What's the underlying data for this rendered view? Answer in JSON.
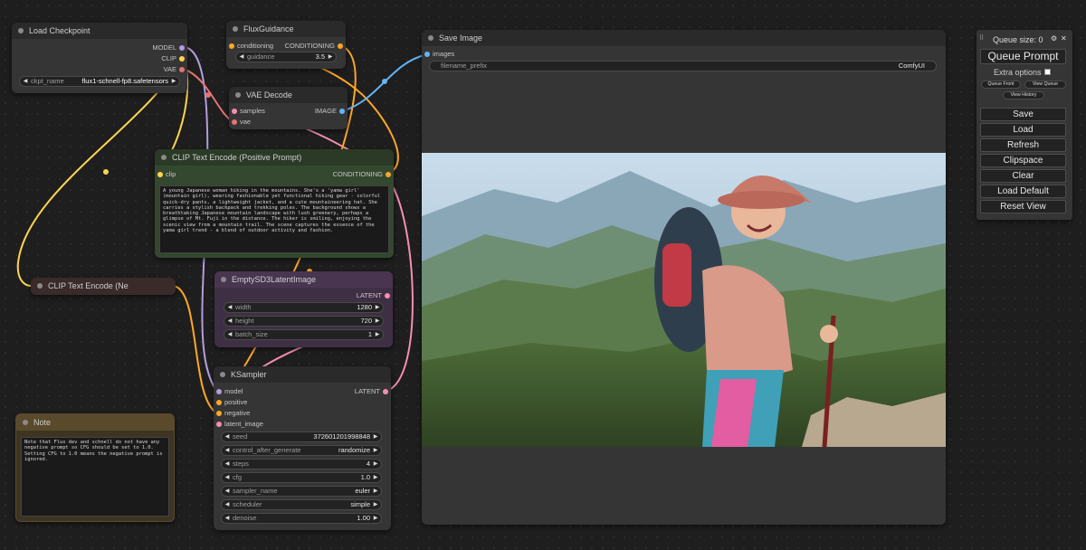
{
  "colors": {
    "canvas": "#1e1e1e",
    "node_body": "#353535",
    "node_title": "#2a2a2a",
    "clip_pos_body": "#34472f",
    "clip_pos_title": "#2a3a26",
    "latent_body": "#3f2f44",
    "latent_title": "#4a3550",
    "note_body": "#3d3522",
    "note_title": "#5a4a2c",
    "model_wire": "#b39ddb",
    "clip_wire": "#ffd54f",
    "vae_wire": "#e57373",
    "conditioning_wire": "#ffa726",
    "image_wire": "#64b5f6",
    "latent_wire": "#f48fb1"
  },
  "load_checkpoint": {
    "title": "Load Checkpoint",
    "outputs": [
      "MODEL",
      "CLIP",
      "VAE"
    ],
    "ckpt_label": "ckpt_name",
    "ckpt_value": "flux1-schnell-fp8.safetensors"
  },
  "flux_guidance": {
    "title": "FluxGuidance",
    "input": "conditioning",
    "output": "CONDITIONING",
    "guidance_label": "guidance",
    "guidance_value": "3.5"
  },
  "vae_decode": {
    "title": "VAE Decode",
    "inputs": [
      "samples",
      "vae"
    ],
    "output": "IMAGE"
  },
  "clip_positive": {
    "title": "CLIP Text Encode (Positive Prompt)",
    "input": "clip",
    "output": "CONDITIONING",
    "text": "A young Japanese woman hiking in the mountains. She's a 'yama girl' (mountain girl), wearing fashionable yet functional hiking gear - colorful quick-dry pants, a lightweight jacket, and a cute mountaineering hat. She carries a stylish backpack and trekking poles. The background shows a breathtaking Japanese mountain landscape with lush greenery, perhaps a glimpse of Mt. Fuji in the distance. The hiker is smiling, enjoying the scenic view from a mountain trail. The scene captures the essence of the yama girl trend - a blend of outdoor activity and fashion."
  },
  "clip_negative": {
    "title": "CLIP Text Encode (Ne"
  },
  "empty_latent": {
    "title": "EmptySD3LatentImage",
    "output": "LATENT",
    "widgets": [
      {
        "label": "width",
        "value": "1280"
      },
      {
        "label": "height",
        "value": "720"
      },
      {
        "label": "batch_size",
        "value": "1"
      }
    ]
  },
  "ksampler": {
    "title": "KSampler",
    "output": "LATENT",
    "inputs": [
      "model",
      "positive",
      "negative",
      "latent_image"
    ],
    "widgets": [
      {
        "label": "seed",
        "value": "372601201998848"
      },
      {
        "label": "control_after_generate",
        "value": "randomize"
      },
      {
        "label": "steps",
        "value": "4"
      },
      {
        "label": "cfg",
        "value": "1.0"
      },
      {
        "label": "sampler_name",
        "value": "euler"
      },
      {
        "label": "scheduler",
        "value": "simple"
      },
      {
        "label": "denoise",
        "value": "1.00"
      }
    ]
  },
  "note": {
    "title": "Note",
    "text": "Note that Flux dev and schnell do not have any negative prompt so CFG should be set to 1.0. Setting CFG to 1.0 means the negative prompt is ignored."
  },
  "save_image": {
    "title": "Save Image",
    "input": "images",
    "prefix_label": "filename_prefix",
    "prefix_value": "ComfyUI"
  },
  "queue_panel": {
    "queue_size": "Queue size: 0",
    "gear_icon": "gear-icon",
    "close_glyph": "✕",
    "queue_prompt": "Queue Prompt",
    "extra_options": "Extra options",
    "queue_front": "Queue Front",
    "view_queue": "View Queue",
    "view_history": "View History",
    "buttons": [
      "Save",
      "Load",
      "Refresh",
      "Clipspace",
      "Clear",
      "Load Default",
      "Reset View"
    ]
  }
}
